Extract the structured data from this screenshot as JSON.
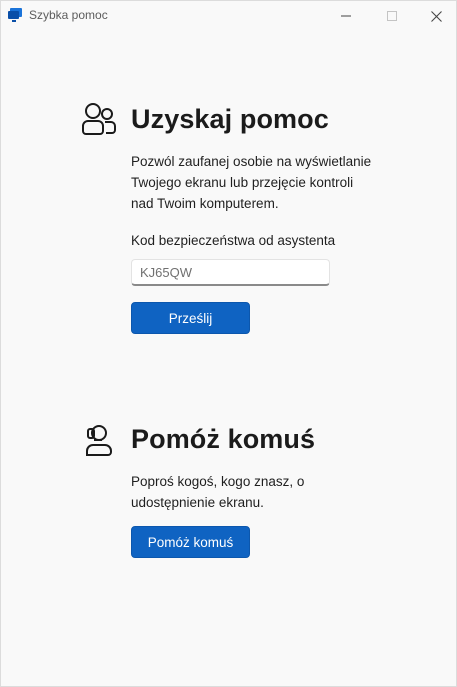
{
  "window": {
    "title": "Szybka pomoc",
    "controls": {
      "minimize": "—",
      "maximize": "☐",
      "close": "✕"
    }
  },
  "get_help": {
    "heading": "Uzyskaj pomoc",
    "description": "Pozwól zaufanej osobie na wyświetlanie\nTwojego ekranu lub przejęcie kontroli\nnad Twoim komputerem.",
    "code_label": "Kod bezpieczeństwa od asystenta",
    "code_value": "KJ65QW",
    "submit_label": "Prześlij",
    "icon": "people-icon"
  },
  "help_someone": {
    "heading": "Pomóż komuś",
    "description": "Poproś kogoś, kogo znasz, o\nudostępnienie ekranu.",
    "button_label": "Pomóż komuś",
    "icon": "person-headset-icon"
  },
  "colors": {
    "accent": "#0f63c2",
    "background": "#f9f9f9"
  }
}
